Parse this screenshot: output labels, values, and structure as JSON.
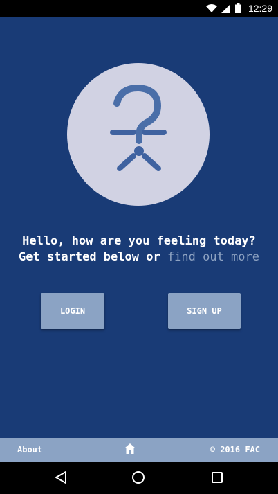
{
  "status_bar": {
    "time": "12:29",
    "icons": [
      "wifi-icon",
      "cell-signal-icon",
      "battery-icon"
    ]
  },
  "logo": {
    "icon": "person-question-mark-logo",
    "circle_color": "#d1d2e3",
    "figure_color": "#4a6ea8"
  },
  "greeting": {
    "line1": "Hello, how are you feeling today?",
    "line2_prefix": "Get started below or",
    "link_text": "find out more"
  },
  "buttons": {
    "login": "LOGIN",
    "signup": "SIGN UP"
  },
  "footer": {
    "about": "About",
    "home_icon": "home-icon",
    "copyright": "© 2016 FAC"
  },
  "nav_bar": {
    "icons": [
      "back-icon",
      "home-circle-icon",
      "recent-apps-icon"
    ]
  },
  "colors": {
    "background": "#193b76",
    "button": "#8ba3c4",
    "link": "#8ea3c2",
    "text": "#ffffff"
  }
}
